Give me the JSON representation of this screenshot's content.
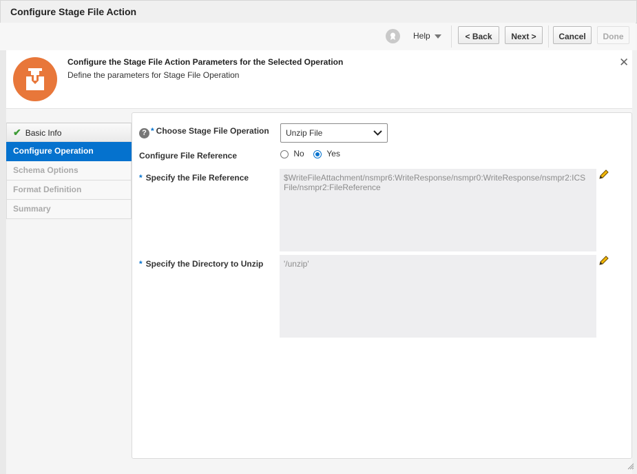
{
  "window": {
    "title": "Configure Stage File Action"
  },
  "toolbar": {
    "info_icon": "ribbon-icon",
    "help_label": "Help",
    "back_label": "< Back",
    "next_label": "Next >",
    "cancel_label": "Cancel",
    "done_label": "Done"
  },
  "header": {
    "icon": "stage-file-icon",
    "title": "Configure the Stage File Action Parameters for the Selected Operation",
    "subtitle": "Define the parameters for Stage File Operation",
    "close_glyph": "✕"
  },
  "nav": {
    "items": [
      {
        "label": "Basic Info",
        "state": "done"
      },
      {
        "label": "Configure Operation",
        "state": "active"
      },
      {
        "label": "Schema Options",
        "state": "disabled"
      },
      {
        "label": "Format Definition",
        "state": "disabled"
      },
      {
        "label": "Summary",
        "state": "disabled"
      }
    ]
  },
  "form": {
    "operation_label": "Choose Stage File Operation",
    "operation_value": "Unzip File",
    "file_ref_config_label": "Configure File Reference",
    "radio_no": "No",
    "radio_yes": "Yes",
    "radio_selected": "Yes",
    "file_ref_label": "Specify the File Reference",
    "file_ref_value": "$WriteFileAttachment/nsmpr6:WriteResponse/nsmpr0:WriteResponse/nsmpr2:ICS File/nsmpr2:FileReference",
    "directory_label": "Specify the Directory to Unzip",
    "directory_value": "'/unzip'"
  },
  "colors": {
    "accent": "#0572ce",
    "icon_orange": "#e8773a",
    "success": "#3d9b35"
  }
}
